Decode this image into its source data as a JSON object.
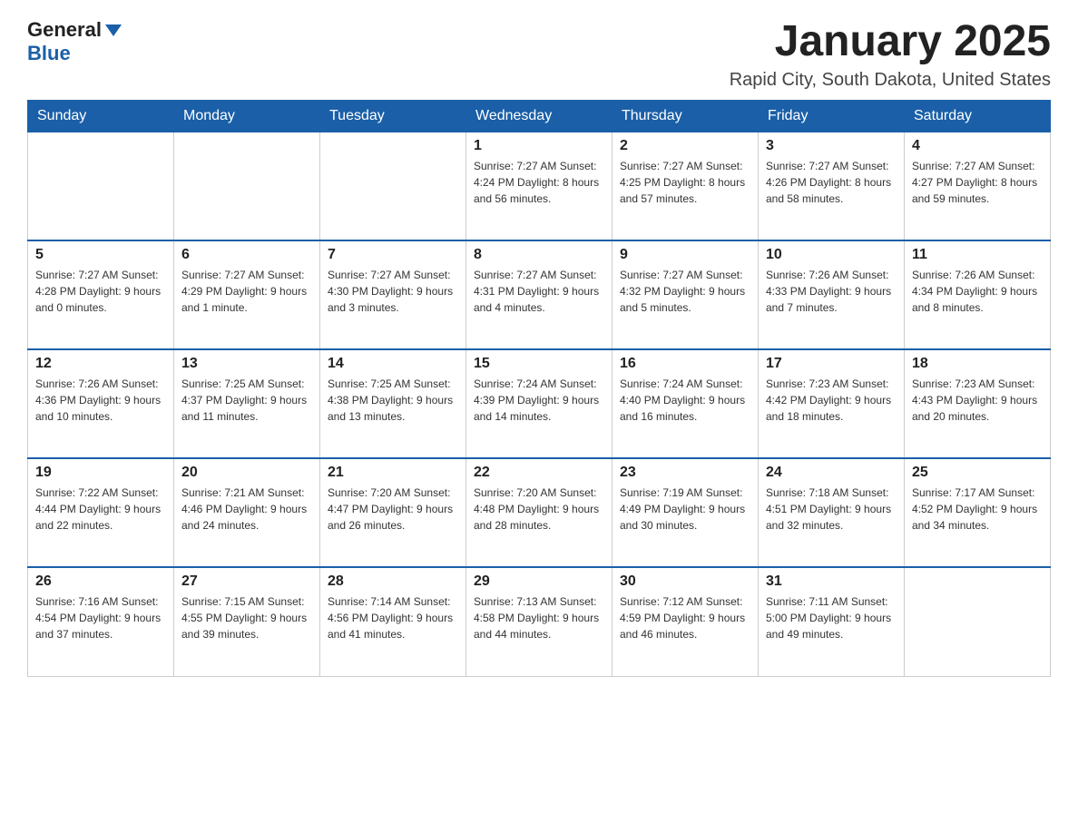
{
  "header": {
    "logo_general": "General",
    "logo_blue": "Blue",
    "month_title": "January 2025",
    "location": "Rapid City, South Dakota, United States"
  },
  "calendar": {
    "days_of_week": [
      "Sunday",
      "Monday",
      "Tuesday",
      "Wednesday",
      "Thursday",
      "Friday",
      "Saturday"
    ],
    "weeks": [
      [
        {
          "day": "",
          "info": ""
        },
        {
          "day": "",
          "info": ""
        },
        {
          "day": "",
          "info": ""
        },
        {
          "day": "1",
          "info": "Sunrise: 7:27 AM\nSunset: 4:24 PM\nDaylight: 8 hours\nand 56 minutes."
        },
        {
          "day": "2",
          "info": "Sunrise: 7:27 AM\nSunset: 4:25 PM\nDaylight: 8 hours\nand 57 minutes."
        },
        {
          "day": "3",
          "info": "Sunrise: 7:27 AM\nSunset: 4:26 PM\nDaylight: 8 hours\nand 58 minutes."
        },
        {
          "day": "4",
          "info": "Sunrise: 7:27 AM\nSunset: 4:27 PM\nDaylight: 8 hours\nand 59 minutes."
        }
      ],
      [
        {
          "day": "5",
          "info": "Sunrise: 7:27 AM\nSunset: 4:28 PM\nDaylight: 9 hours\nand 0 minutes."
        },
        {
          "day": "6",
          "info": "Sunrise: 7:27 AM\nSunset: 4:29 PM\nDaylight: 9 hours\nand 1 minute."
        },
        {
          "day": "7",
          "info": "Sunrise: 7:27 AM\nSunset: 4:30 PM\nDaylight: 9 hours\nand 3 minutes."
        },
        {
          "day": "8",
          "info": "Sunrise: 7:27 AM\nSunset: 4:31 PM\nDaylight: 9 hours\nand 4 minutes."
        },
        {
          "day": "9",
          "info": "Sunrise: 7:27 AM\nSunset: 4:32 PM\nDaylight: 9 hours\nand 5 minutes."
        },
        {
          "day": "10",
          "info": "Sunrise: 7:26 AM\nSunset: 4:33 PM\nDaylight: 9 hours\nand 7 minutes."
        },
        {
          "day": "11",
          "info": "Sunrise: 7:26 AM\nSunset: 4:34 PM\nDaylight: 9 hours\nand 8 minutes."
        }
      ],
      [
        {
          "day": "12",
          "info": "Sunrise: 7:26 AM\nSunset: 4:36 PM\nDaylight: 9 hours\nand 10 minutes."
        },
        {
          "day": "13",
          "info": "Sunrise: 7:25 AM\nSunset: 4:37 PM\nDaylight: 9 hours\nand 11 minutes."
        },
        {
          "day": "14",
          "info": "Sunrise: 7:25 AM\nSunset: 4:38 PM\nDaylight: 9 hours\nand 13 minutes."
        },
        {
          "day": "15",
          "info": "Sunrise: 7:24 AM\nSunset: 4:39 PM\nDaylight: 9 hours\nand 14 minutes."
        },
        {
          "day": "16",
          "info": "Sunrise: 7:24 AM\nSunset: 4:40 PM\nDaylight: 9 hours\nand 16 minutes."
        },
        {
          "day": "17",
          "info": "Sunrise: 7:23 AM\nSunset: 4:42 PM\nDaylight: 9 hours\nand 18 minutes."
        },
        {
          "day": "18",
          "info": "Sunrise: 7:23 AM\nSunset: 4:43 PM\nDaylight: 9 hours\nand 20 minutes."
        }
      ],
      [
        {
          "day": "19",
          "info": "Sunrise: 7:22 AM\nSunset: 4:44 PM\nDaylight: 9 hours\nand 22 minutes."
        },
        {
          "day": "20",
          "info": "Sunrise: 7:21 AM\nSunset: 4:46 PM\nDaylight: 9 hours\nand 24 minutes."
        },
        {
          "day": "21",
          "info": "Sunrise: 7:20 AM\nSunset: 4:47 PM\nDaylight: 9 hours\nand 26 minutes."
        },
        {
          "day": "22",
          "info": "Sunrise: 7:20 AM\nSunset: 4:48 PM\nDaylight: 9 hours\nand 28 minutes."
        },
        {
          "day": "23",
          "info": "Sunrise: 7:19 AM\nSunset: 4:49 PM\nDaylight: 9 hours\nand 30 minutes."
        },
        {
          "day": "24",
          "info": "Sunrise: 7:18 AM\nSunset: 4:51 PM\nDaylight: 9 hours\nand 32 minutes."
        },
        {
          "day": "25",
          "info": "Sunrise: 7:17 AM\nSunset: 4:52 PM\nDaylight: 9 hours\nand 34 minutes."
        }
      ],
      [
        {
          "day": "26",
          "info": "Sunrise: 7:16 AM\nSunset: 4:54 PM\nDaylight: 9 hours\nand 37 minutes."
        },
        {
          "day": "27",
          "info": "Sunrise: 7:15 AM\nSunset: 4:55 PM\nDaylight: 9 hours\nand 39 minutes."
        },
        {
          "day": "28",
          "info": "Sunrise: 7:14 AM\nSunset: 4:56 PM\nDaylight: 9 hours\nand 41 minutes."
        },
        {
          "day": "29",
          "info": "Sunrise: 7:13 AM\nSunset: 4:58 PM\nDaylight: 9 hours\nand 44 minutes."
        },
        {
          "day": "30",
          "info": "Sunrise: 7:12 AM\nSunset: 4:59 PM\nDaylight: 9 hours\nand 46 minutes."
        },
        {
          "day": "31",
          "info": "Sunrise: 7:11 AM\nSunset: 5:00 PM\nDaylight: 9 hours\nand 49 minutes."
        },
        {
          "day": "",
          "info": ""
        }
      ]
    ]
  }
}
